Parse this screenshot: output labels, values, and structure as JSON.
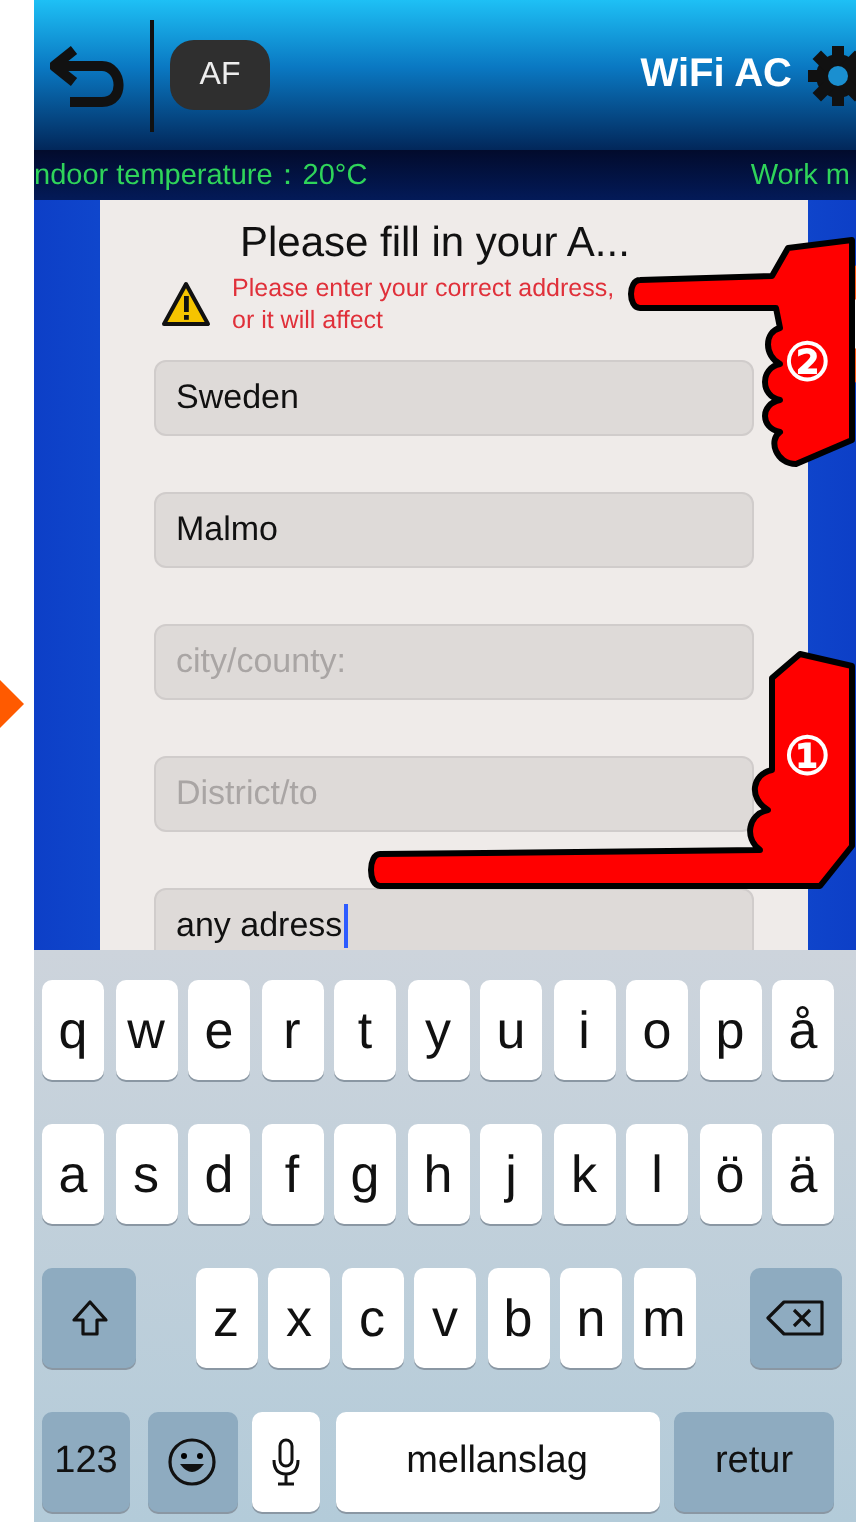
{
  "header": {
    "af_button": "AF",
    "title": "WiFi AC"
  },
  "status_line": [
    "ndoor temperature：20°C",
    "Work m"
  ],
  "dialog": {
    "title": "Please fill in your A...",
    "warning": [
      "Please enter your correct address,",
      "or it will affect"
    ],
    "fields": [
      {
        "value": "Sweden",
        "focused": false
      },
      {
        "value": "Malmo",
        "focused": false
      },
      {
        "placeholder": "city/county:",
        "focused": false
      },
      {
        "placeholder": "District/to",
        "focused": false
      },
      {
        "value": "any adress",
        "focused": true
      }
    ]
  },
  "annotations": [
    {
      "label": "②"
    },
    {
      "label": "①"
    }
  ],
  "keyboard": {
    "top_row": [
      "q",
      "w",
      "e",
      "r",
      "t",
      "y",
      "u",
      "i",
      "o",
      "p",
      "å"
    ],
    "middle_row": [
      "a",
      "s",
      "d",
      "f",
      "g",
      "h",
      "j",
      "k",
      "l",
      "ö",
      "ä"
    ],
    "bottom_row": [
      "z",
      "x",
      "c",
      "v",
      "b",
      "n",
      "m"
    ],
    "numbers_key": "123",
    "space_key": "mellanslag",
    "return_key": "retur"
  }
}
